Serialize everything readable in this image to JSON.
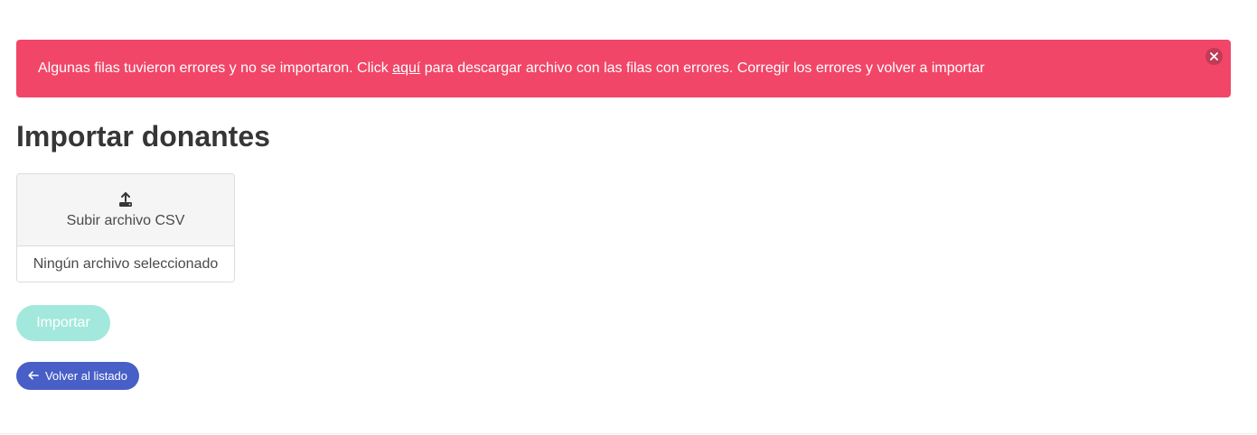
{
  "notification": {
    "text_before": "Algunas filas tuvieron errores y no se importaron. Click ",
    "link_text": "aquí",
    "text_after": " para descargar archivo con las filas con errores. Corregir los errores y volver a importar",
    "color": "#f14668",
    "close_icon": "close-icon"
  },
  "page": {
    "title": "Importar donantes"
  },
  "file_upload": {
    "cta_label": "Subir archivo CSV",
    "icon": "upload-icon",
    "file_name": "Ningún archivo seleccionado"
  },
  "actions": {
    "import_label": "Importar",
    "import_color": "#a3e8dc",
    "back_label": "Volver al listado",
    "back_icon": "arrow-left-icon",
    "back_color": "#485fc7"
  }
}
